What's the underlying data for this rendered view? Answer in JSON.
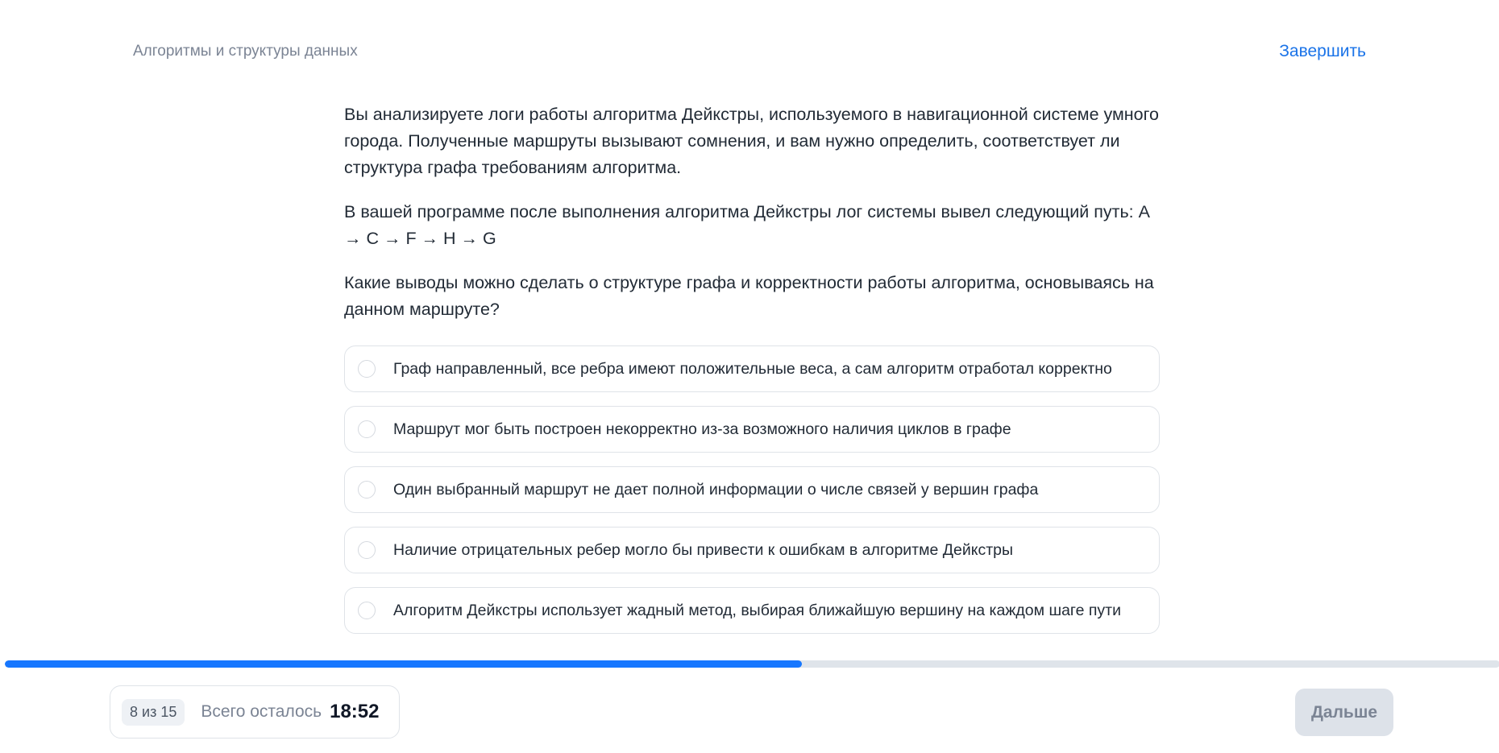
{
  "header": {
    "course_title": "Алгоритмы и структуры данных",
    "finish_label": "Завершить"
  },
  "question": {
    "paragraphs": [
      "Вы анализируете логи работы алгоритма Дейкстры, используемого в навигационной системе умного города. Полученные маршруты вызывают сомнения, и вам нужно определить, соответствует ли структура графа требованиям алгоритма.",
      "В вашей программе после выполнения алгоритма Дейкстры лог системы вывел следующий путь: A → C → F → H → G",
      "Какие выводы можно сделать о структуре графа и корректности работы алгоритма, основываясь на данном маршруте?"
    ]
  },
  "options": [
    {
      "label": "Граф направленный, все ребра имеют положительные веса, а сам алгоритм отработал корректно",
      "selected": false
    },
    {
      "label": "Маршрут мог быть построен некорректно из-за возможного наличия циклов в графе",
      "selected": false
    },
    {
      "label": "Один выбранный маршрут не дает полной информации о числе связей у вершин графа",
      "selected": false
    },
    {
      "label": "Наличие отрицательных ребер могло бы привести к ошибкам в алгоритме Дейкстры",
      "selected": false
    },
    {
      "label": "Алгоритм Дейкстры использует жадный метод, выбирая ближайшую вершину на каждом шаге пути",
      "selected": false
    }
  ],
  "progress": {
    "fraction": 0.533,
    "fill_color": "#1677ff",
    "track_color": "#dfe4ea"
  },
  "footer": {
    "step_label": "8 из 15",
    "remaining_label": "Всего осталось",
    "timer": "18:52",
    "next_label": "Дальше"
  },
  "colors": {
    "accent": "#1a73e8",
    "muted_text": "#7b8494",
    "disabled_button_bg": "#dde2e9"
  }
}
